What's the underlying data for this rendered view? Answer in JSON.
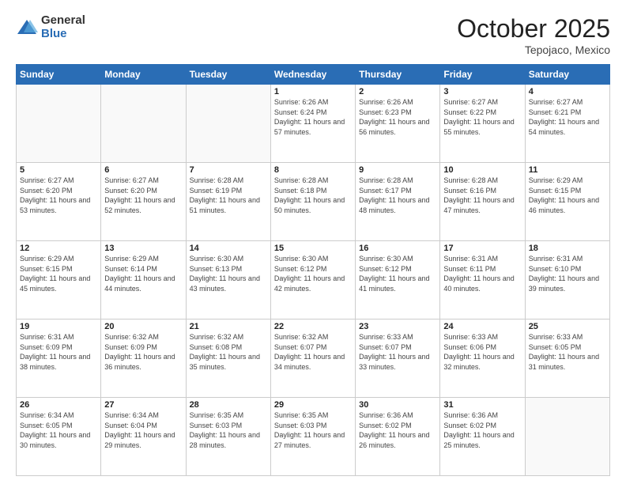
{
  "logo": {
    "general": "General",
    "blue": "Blue"
  },
  "header": {
    "month": "October 2025",
    "location": "Tepojaco, Mexico"
  },
  "days_of_week": [
    "Sunday",
    "Monday",
    "Tuesday",
    "Wednesday",
    "Thursday",
    "Friday",
    "Saturday"
  ],
  "weeks": [
    [
      {
        "day": "",
        "sunrise": "",
        "sunset": "",
        "daylight": ""
      },
      {
        "day": "",
        "sunrise": "",
        "sunset": "",
        "daylight": ""
      },
      {
        "day": "",
        "sunrise": "",
        "sunset": "",
        "daylight": ""
      },
      {
        "day": "1",
        "sunrise": "6:26 AM",
        "sunset": "6:24 PM",
        "daylight": "11 hours and 57 minutes."
      },
      {
        "day": "2",
        "sunrise": "6:26 AM",
        "sunset": "6:23 PM",
        "daylight": "11 hours and 56 minutes."
      },
      {
        "day": "3",
        "sunrise": "6:27 AM",
        "sunset": "6:22 PM",
        "daylight": "11 hours and 55 minutes."
      },
      {
        "day": "4",
        "sunrise": "6:27 AM",
        "sunset": "6:21 PM",
        "daylight": "11 hours and 54 minutes."
      }
    ],
    [
      {
        "day": "5",
        "sunrise": "6:27 AM",
        "sunset": "6:20 PM",
        "daylight": "11 hours and 53 minutes."
      },
      {
        "day": "6",
        "sunrise": "6:27 AM",
        "sunset": "6:20 PM",
        "daylight": "11 hours and 52 minutes."
      },
      {
        "day": "7",
        "sunrise": "6:28 AM",
        "sunset": "6:19 PM",
        "daylight": "11 hours and 51 minutes."
      },
      {
        "day": "8",
        "sunrise": "6:28 AM",
        "sunset": "6:18 PM",
        "daylight": "11 hours and 50 minutes."
      },
      {
        "day": "9",
        "sunrise": "6:28 AM",
        "sunset": "6:17 PM",
        "daylight": "11 hours and 48 minutes."
      },
      {
        "day": "10",
        "sunrise": "6:28 AM",
        "sunset": "6:16 PM",
        "daylight": "11 hours and 47 minutes."
      },
      {
        "day": "11",
        "sunrise": "6:29 AM",
        "sunset": "6:15 PM",
        "daylight": "11 hours and 46 minutes."
      }
    ],
    [
      {
        "day": "12",
        "sunrise": "6:29 AM",
        "sunset": "6:15 PM",
        "daylight": "11 hours and 45 minutes."
      },
      {
        "day": "13",
        "sunrise": "6:29 AM",
        "sunset": "6:14 PM",
        "daylight": "11 hours and 44 minutes."
      },
      {
        "day": "14",
        "sunrise": "6:30 AM",
        "sunset": "6:13 PM",
        "daylight": "11 hours and 43 minutes."
      },
      {
        "day": "15",
        "sunrise": "6:30 AM",
        "sunset": "6:12 PM",
        "daylight": "11 hours and 42 minutes."
      },
      {
        "day": "16",
        "sunrise": "6:30 AM",
        "sunset": "6:12 PM",
        "daylight": "11 hours and 41 minutes."
      },
      {
        "day": "17",
        "sunrise": "6:31 AM",
        "sunset": "6:11 PM",
        "daylight": "11 hours and 40 minutes."
      },
      {
        "day": "18",
        "sunrise": "6:31 AM",
        "sunset": "6:10 PM",
        "daylight": "11 hours and 39 minutes."
      }
    ],
    [
      {
        "day": "19",
        "sunrise": "6:31 AM",
        "sunset": "6:09 PM",
        "daylight": "11 hours and 38 minutes."
      },
      {
        "day": "20",
        "sunrise": "6:32 AM",
        "sunset": "6:09 PM",
        "daylight": "11 hours and 36 minutes."
      },
      {
        "day": "21",
        "sunrise": "6:32 AM",
        "sunset": "6:08 PM",
        "daylight": "11 hours and 35 minutes."
      },
      {
        "day": "22",
        "sunrise": "6:32 AM",
        "sunset": "6:07 PM",
        "daylight": "11 hours and 34 minutes."
      },
      {
        "day": "23",
        "sunrise": "6:33 AM",
        "sunset": "6:07 PM",
        "daylight": "11 hours and 33 minutes."
      },
      {
        "day": "24",
        "sunrise": "6:33 AM",
        "sunset": "6:06 PM",
        "daylight": "11 hours and 32 minutes."
      },
      {
        "day": "25",
        "sunrise": "6:33 AM",
        "sunset": "6:05 PM",
        "daylight": "11 hours and 31 minutes."
      }
    ],
    [
      {
        "day": "26",
        "sunrise": "6:34 AM",
        "sunset": "6:05 PM",
        "daylight": "11 hours and 30 minutes."
      },
      {
        "day": "27",
        "sunrise": "6:34 AM",
        "sunset": "6:04 PM",
        "daylight": "11 hours and 29 minutes."
      },
      {
        "day": "28",
        "sunrise": "6:35 AM",
        "sunset": "6:03 PM",
        "daylight": "11 hours and 28 minutes."
      },
      {
        "day": "29",
        "sunrise": "6:35 AM",
        "sunset": "6:03 PM",
        "daylight": "11 hours and 27 minutes."
      },
      {
        "day": "30",
        "sunrise": "6:36 AM",
        "sunset": "6:02 PM",
        "daylight": "11 hours and 26 minutes."
      },
      {
        "day": "31",
        "sunrise": "6:36 AM",
        "sunset": "6:02 PM",
        "daylight": "11 hours and 25 minutes."
      },
      {
        "day": "",
        "sunrise": "",
        "sunset": "",
        "daylight": ""
      }
    ]
  ],
  "labels": {
    "sunrise": "Sunrise:",
    "sunset": "Sunset:",
    "daylight": "Daylight:"
  }
}
